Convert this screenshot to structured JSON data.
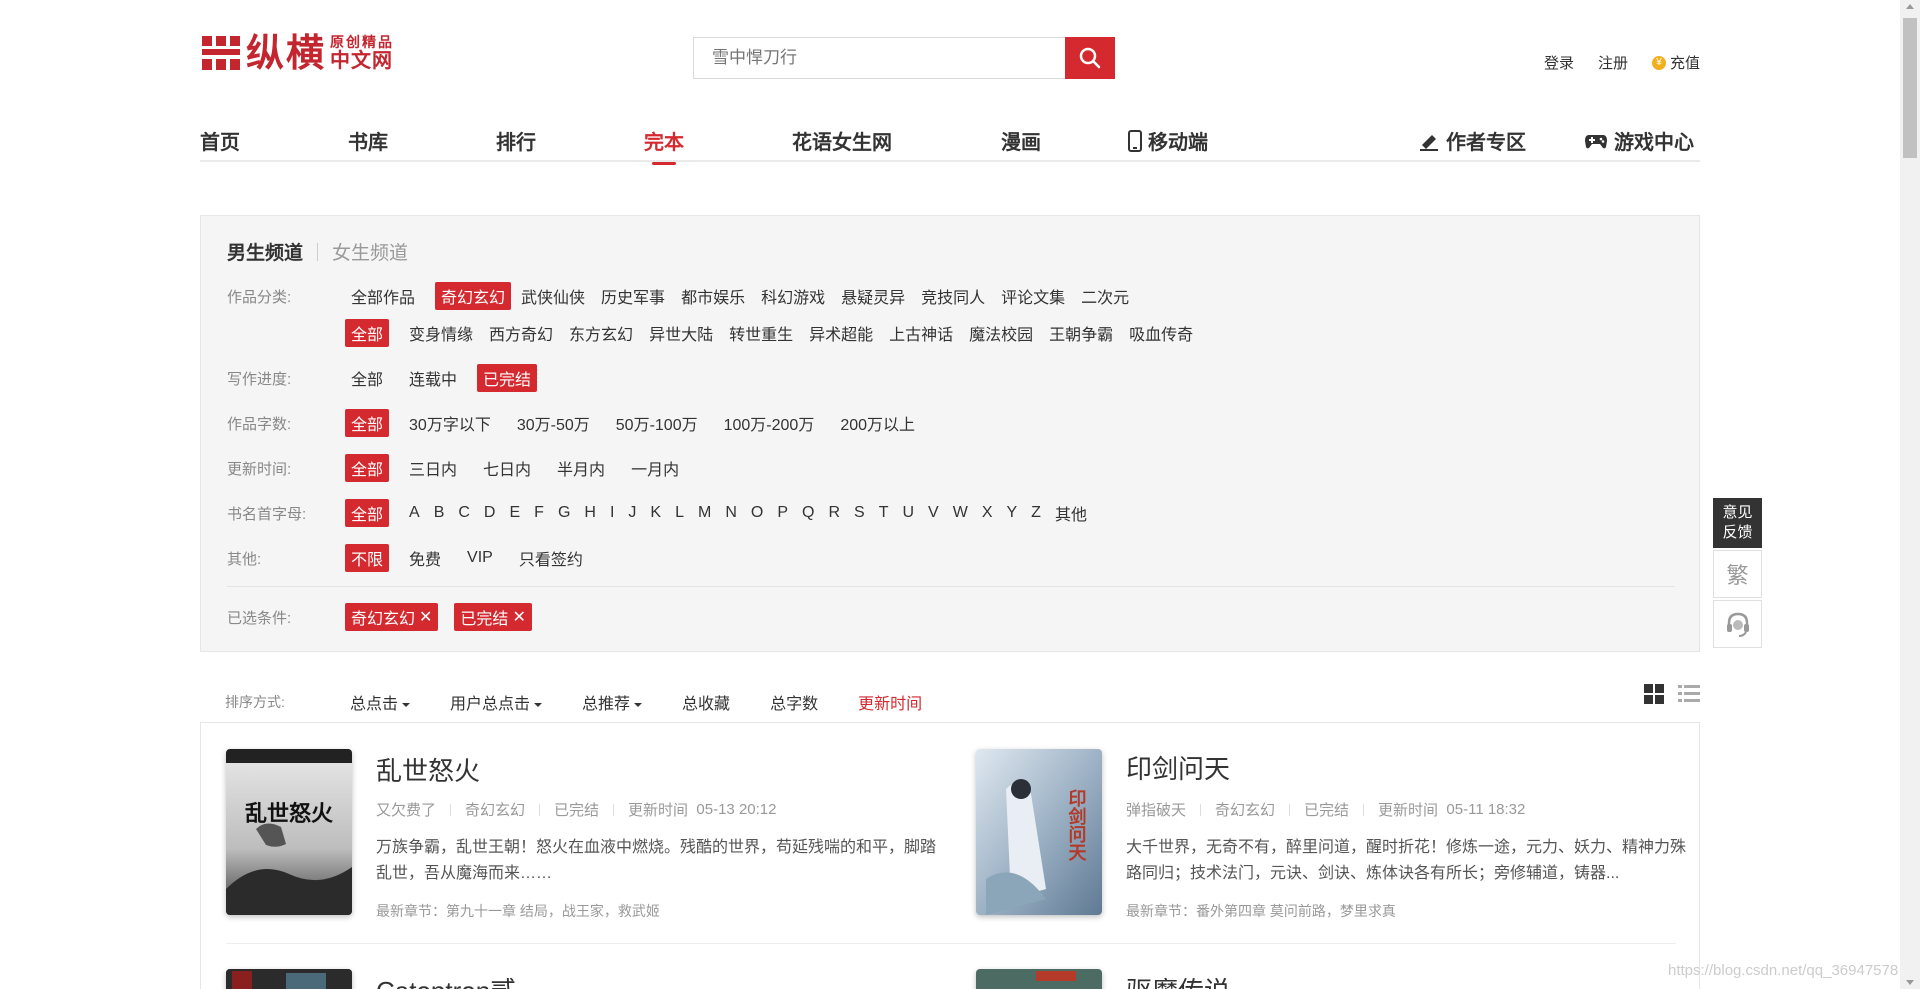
{
  "header": {
    "logo_main": "纵横",
    "logo_sub_top": "原创精品",
    "logo_sub_bottom": "中文网",
    "search_placeholder": "雪中悍刀行",
    "login": "登录",
    "register": "注册",
    "recharge": "充值"
  },
  "nav": {
    "items": [
      "首页",
      "书库",
      "排行",
      "完本",
      "花语女生网",
      "漫画",
      "移动端"
    ],
    "author_zone": "作者专区",
    "game_center": "游戏中心"
  },
  "filter": {
    "tab_male": "男生频道",
    "tab_female": "女生频道",
    "category_label": "作品分类:",
    "categories": [
      "全部作品",
      "奇幻玄幻",
      "武侠仙侠",
      "历史军事",
      "都市娱乐",
      "科幻游戏",
      "悬疑灵异",
      "竞技同人",
      "评论文集",
      "二次元"
    ],
    "subcategories": [
      "全部",
      "变身情缘",
      "西方奇幻",
      "东方玄幻",
      "异世大陆",
      "转世重生",
      "异术超能",
      "上古神话",
      "魔法校园",
      "王朝争霸",
      "吸血传奇"
    ],
    "progress_label": "写作进度:",
    "progress": [
      "全部",
      "连载中",
      "已完结"
    ],
    "words_label": "作品字数:",
    "words": [
      "全部",
      "30万字以下",
      "30万-50万",
      "50万-100万",
      "100万-200万",
      "200万以上"
    ],
    "update_label": "更新时间:",
    "update": [
      "全部",
      "三日内",
      "七日内",
      "半月内",
      "一月内"
    ],
    "initial_label": "书名首字母:",
    "initials": [
      "全部",
      "A",
      "B",
      "C",
      "D",
      "E",
      "F",
      "G",
      "H",
      "I",
      "J",
      "K",
      "L",
      "M",
      "N",
      "O",
      "P",
      "Q",
      "R",
      "S",
      "T",
      "U",
      "V",
      "W",
      "X",
      "Y",
      "Z",
      "其他"
    ],
    "other_label": "其他:",
    "other": [
      "不限",
      "免费",
      "VIP",
      "只看签约"
    ],
    "selected_label": "已选条件:",
    "selected": [
      "奇幻玄幻",
      "已完结"
    ]
  },
  "sort": {
    "label": "排序方式:",
    "items": [
      "总点击",
      "用户总点击",
      "总推荐",
      "总收藏",
      "总字数",
      "更新时间"
    ]
  },
  "books": [
    {
      "title": "乱世怒火",
      "author": "又欠费了",
      "category": "奇幻玄幻",
      "status": "已完结",
      "update_label": "更新时间",
      "update_time": "05-13 20:12",
      "desc": "万族争霸，乱世王朝！怒火在血液中燃烧。残酷的世界，苟延残喘的和平，脚踏乱世，吾从魔海而来……",
      "latest": "最新章节：第九十一章 结局，战王家，救武姬",
      "cover_text": "乱世怒火"
    },
    {
      "title": "印剑问天",
      "author": "弹指破天",
      "category": "奇幻玄幻",
      "status": "已完结",
      "update_label": "更新时间",
      "update_time": "05-11 18:32",
      "desc": "大千世界，无奇不有，醉里问道，醒时折花！修炼一途，元力、妖力、精神力殊路同归；技术法门，元诀、剑诀、炼体诀各有所长；旁修辅道，铸器...",
      "latest": "最新章节：番外第四章 莫问前路，梦里求真",
      "cover_text": "印剑问天"
    },
    {
      "title": "Catoptron贰"
    },
    {
      "title": "驱魔传说"
    }
  ],
  "side": {
    "feedback": "意见反馈",
    "traditional": "繁"
  },
  "watermark": "https://blog.csdn.net/qq_36947578"
}
